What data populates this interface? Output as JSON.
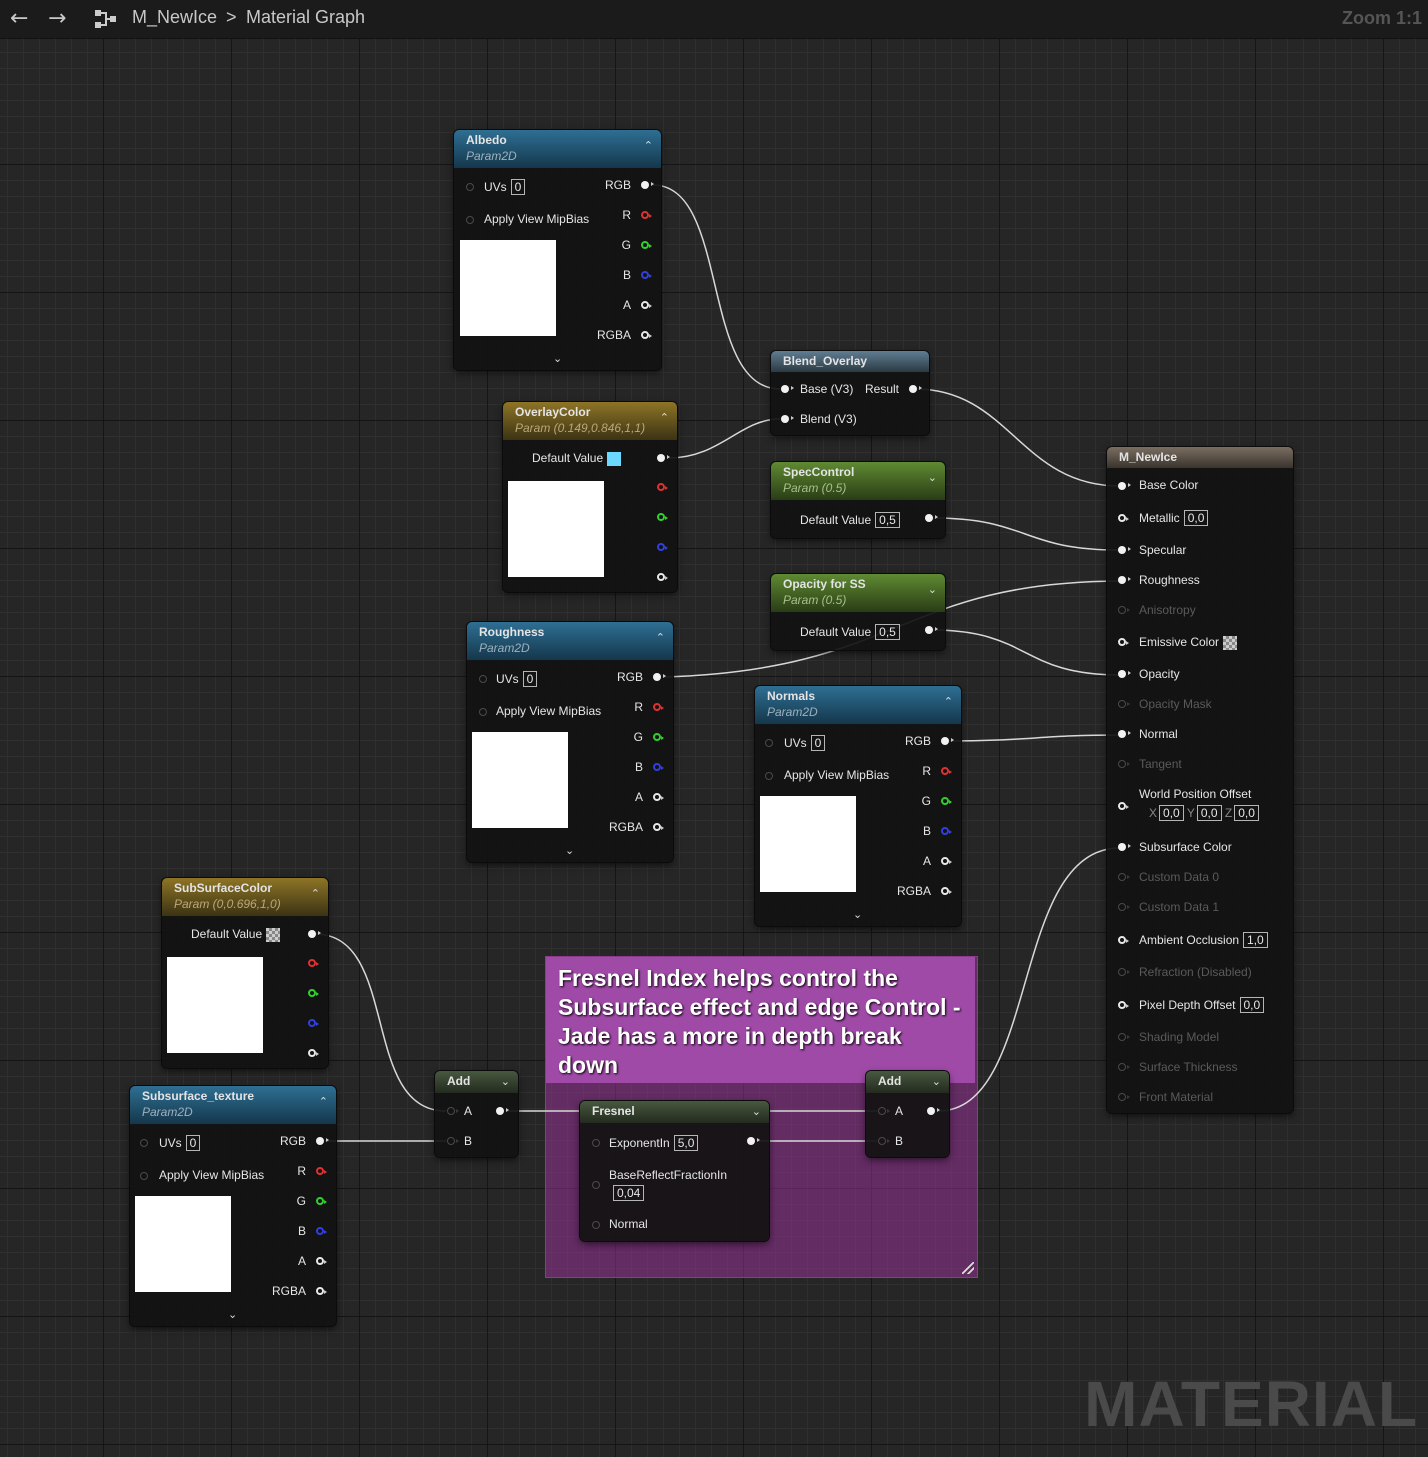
{
  "toolbar": {
    "back_icon": "back-arrow-icon",
    "forward_icon": "forward-arrow-icon",
    "graph_icon": "graph-icon",
    "asset": "M_NewIce",
    "separator": ">",
    "graph": "Material Graph",
    "zoom": "Zoom 1:1"
  },
  "watermark": "MATERIAL",
  "comment": {
    "text": "Fresnel Index helps control the Subsurface effect and edge Control - Jade has a more in depth break down"
  },
  "albedo": {
    "title": "Albedo",
    "subtitle": "Param2D",
    "uvs_label": "UVs",
    "uvs_value": "0",
    "mip_label": "Apply View MipBias",
    "outputs": [
      "RGB",
      "R",
      "G",
      "B",
      "A",
      "RGBA"
    ]
  },
  "overlay": {
    "title": "OverlayColor",
    "subtitle": "Param (0.149,0.846,1,1)",
    "default_label": "Default Value",
    "color": "#6bd8ff"
  },
  "blend": {
    "title": "Blend_Overlay",
    "base": "Base (V3)",
    "result": "Result",
    "blend": "Blend (V3)"
  },
  "spec": {
    "title": "SpecControl",
    "subtitle": "Param (0.5)",
    "default_label": "Default Value",
    "value": "0,5"
  },
  "opacity_ss": {
    "title": "Opacity for SS",
    "subtitle": "Param (0.5)",
    "default_label": "Default Value",
    "value": "0,5"
  },
  "roughness": {
    "title": "Roughness",
    "subtitle": "Param2D",
    "uvs_label": "UVs",
    "uvs_value": "0",
    "mip_label": "Apply View MipBias",
    "outputs": [
      "RGB",
      "R",
      "G",
      "B",
      "A",
      "RGBA"
    ]
  },
  "normals": {
    "title": "Normals",
    "subtitle": "Param2D",
    "uvs_label": "UVs",
    "uvs_value": "0",
    "mip_label": "Apply View MipBias",
    "outputs": [
      "RGB",
      "R",
      "G",
      "B",
      "A",
      "RGBA"
    ]
  },
  "sss_color": {
    "title": "SubSurfaceColor",
    "subtitle": "Param (0,0.696,1,0)",
    "default_label": "Default Value"
  },
  "sss_tex": {
    "title": "Subsurface_texture",
    "subtitle": "Param2D",
    "uvs_label": "UVs",
    "uvs_value": "0",
    "mip_label": "Apply View MipBias",
    "outputs": [
      "RGB",
      "R",
      "G",
      "B",
      "A",
      "RGBA"
    ]
  },
  "add1": {
    "title": "Add",
    "a": "A",
    "b": "B"
  },
  "add2": {
    "title": "Add",
    "a": "A",
    "b": "B"
  },
  "fresnel": {
    "title": "Fresnel",
    "exponent_label": "ExponentIn",
    "exponent_value": "5,0",
    "base_label": "BaseReflectFractionIn",
    "base_value": "0,04",
    "normal_label": "Normal"
  },
  "result": {
    "title": "M_NewIce",
    "base_color": "Base Color",
    "metallic": "Metallic",
    "metallic_value": "0,0",
    "specular": "Specular",
    "roughness": "Roughness",
    "anisotropy": "Anisotropy",
    "emissive": "Emissive Color",
    "opacity": "Opacity",
    "opacity_mask": "Opacity Mask",
    "normal": "Normal",
    "tangent": "Tangent",
    "wpo": "World Position Offset",
    "wpo_x_label": "X",
    "wpo_x": "0,0",
    "wpo_y_label": "Y",
    "wpo_y": "0,0",
    "wpo_z_label": "Z",
    "wpo_z": "0,0",
    "subsurface": "Subsurface Color",
    "custom0": "Custom Data 0",
    "custom1": "Custom Data 1",
    "ao": "Ambient Occlusion",
    "ao_value": "1,0",
    "refraction": "Refraction (Disabled)",
    "pdo": "Pixel Depth Offset",
    "pdo_value": "0,0",
    "shading": "Shading Model",
    "thickness": "Surface Thickness",
    "front": "Front Material"
  }
}
